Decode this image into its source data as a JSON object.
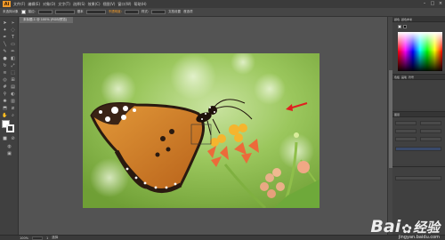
{
  "app": {
    "logo": "Ai",
    "menu": [
      "文件(F)",
      "编辑(E)",
      "对象(O)",
      "文字(T)",
      "选择(S)",
      "效果(C)",
      "视图(V)",
      "窗口(W)",
      "帮助(H)"
    ]
  },
  "controlbar": {
    "selection_label": "未选择对象",
    "stroke_label": "描边:",
    "basic_label": "基本",
    "opacity_label": "不透明度:",
    "style_label": "样式:",
    "doc_setup_label": "文档设置",
    "prefs_label": "首选项"
  },
  "document_tab": {
    "title": "未标题-1 @ 100% (RGB/预览)"
  },
  "panels": {
    "color_tabs": [
      "颜色",
      "颜色参考"
    ],
    "lower_tabs": [
      "色板",
      "画笔",
      "符号"
    ],
    "appearance_tab": "图层"
  },
  "statusbar": {
    "zoom": "100%",
    "page": "1",
    "mode": "选择"
  },
  "watermark": {
    "brand": "Bai",
    "brand2": "经验",
    "sub": "jingyan.baidu.com"
  },
  "colors": {
    "annotation_arrow": "#e02020",
    "accent": "#f09a2a"
  }
}
